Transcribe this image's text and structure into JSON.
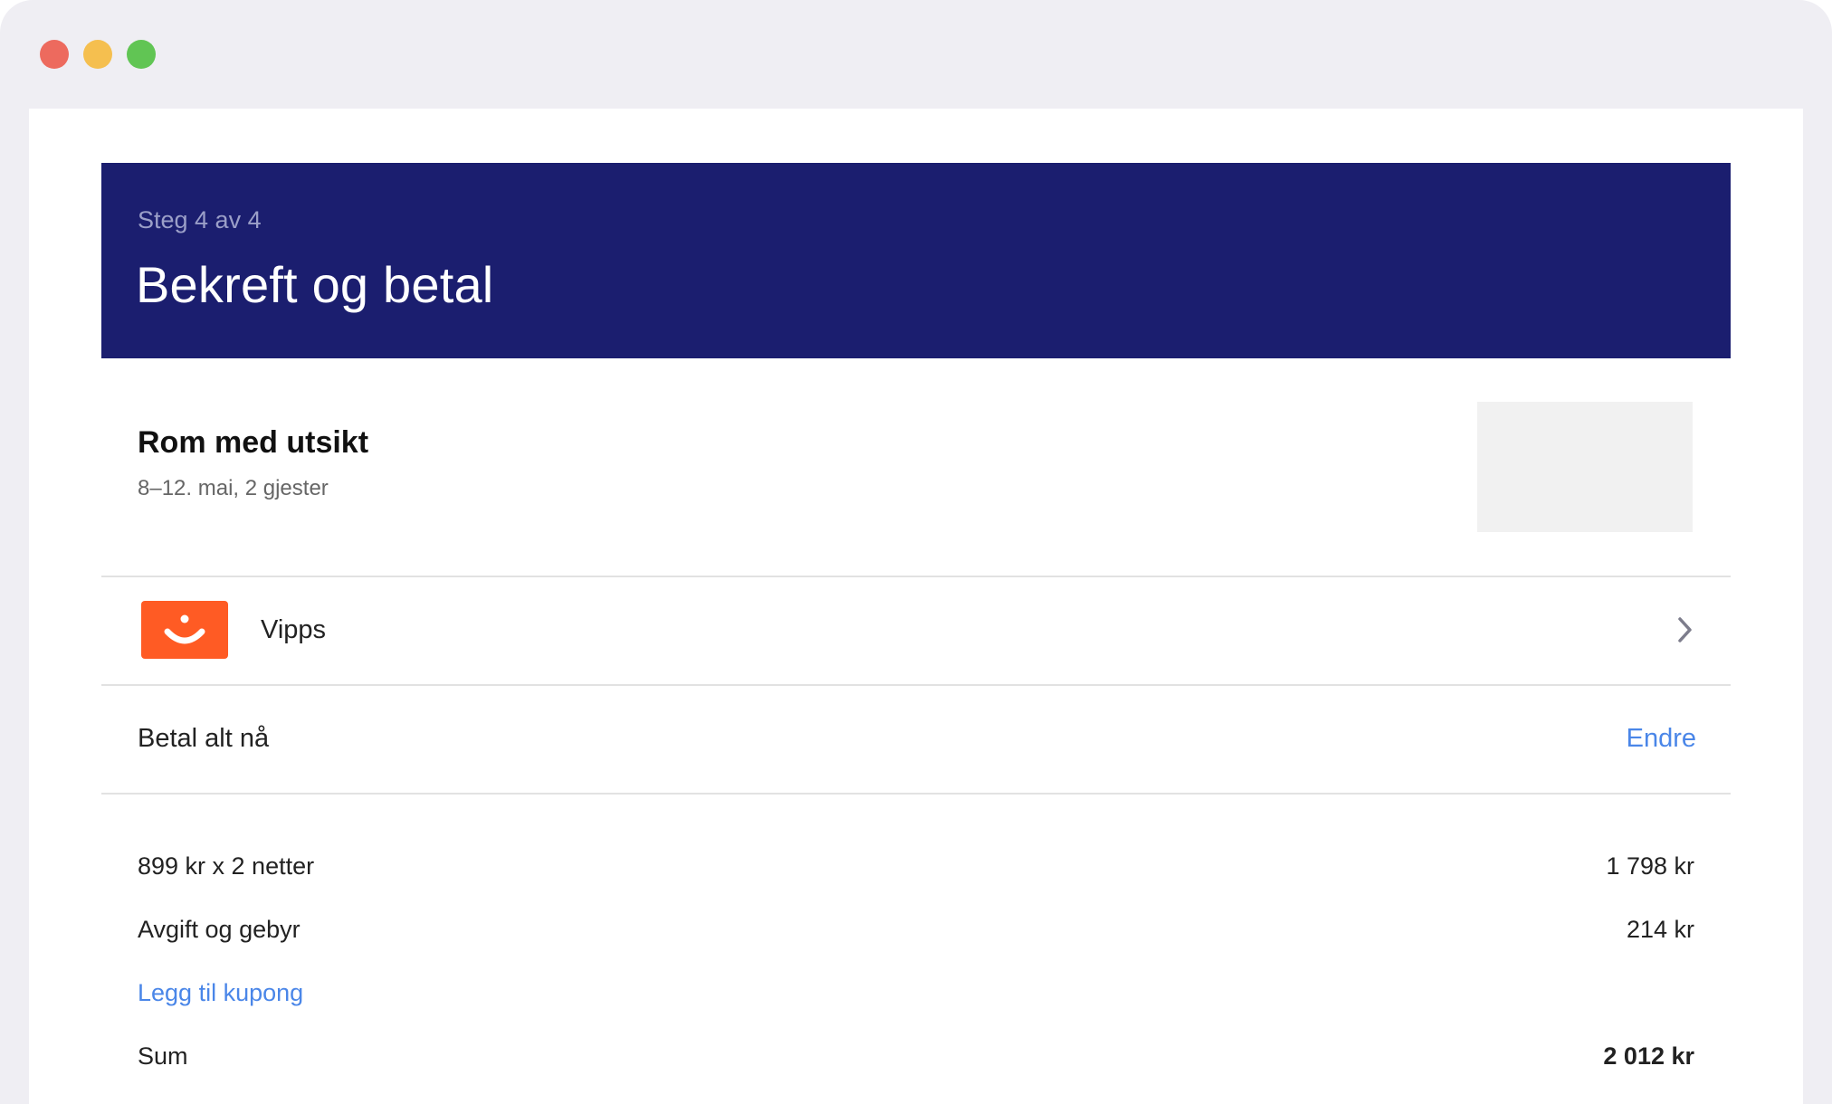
{
  "header": {
    "step": "Steg 4 av 4",
    "title": "Bekreft og betal"
  },
  "room": {
    "name": "Rom med utsikt",
    "details": "8–12. mai, 2 gjester"
  },
  "payment": {
    "method": "Vipps",
    "logo_icon": "vipps-smile-icon",
    "logo_color": "#ff5b24"
  },
  "plan": {
    "label": "Betal alt nå",
    "change_link": "Endre"
  },
  "summary": {
    "rows": [
      {
        "label": "899 kr x 2 netter",
        "value": "1 798 kr"
      },
      {
        "label": "Avgift og gebyr",
        "value": "214 kr"
      }
    ],
    "coupon_link": "Legg til kupong",
    "total_label": "Sum",
    "total_value": "2 012 kr"
  },
  "colors": {
    "header_bg": "#1b1e6f",
    "link": "#4a86e8",
    "window_chrome": "#efeef3"
  }
}
